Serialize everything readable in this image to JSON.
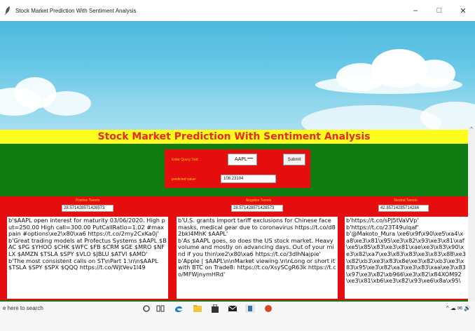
{
  "window": {
    "title": "Stock Market Prediction With Sentiment Analysis",
    "controls": {
      "minimize": "–",
      "maximize": "□",
      "close": "✕"
    }
  },
  "header": {
    "title": "Stock Market Prediction With Sentiment Analysis"
  },
  "query": {
    "label": "Enter Query Text:",
    "selected": "AAPL",
    "submit_label": "Submit",
    "predicted_label": "predicted value:",
    "predicted_value": "108.23104"
  },
  "columns": {
    "positive": {
      "label": "Positive Tweets",
      "score": "28.571428571428573",
      "lines": [
        "b'$AAPL open interest for maturity 03/06/2020. High put=250.00 High call=300.00 PutCallRatio=1.02 #maxpain #options\\xe2\\x80\\xa6 https://t.co/2my2CxKa0j'",
        "b'Great trading models at Profectus Systems $AAPL $BAC $PG $YHOO $CHK $WFC $FB $CRM $GE $MRO $NFLX $AMZN $TSLA $SPY $VLO $JBLU $ATVI $AMD'",
        "b'The most consistent calls on ST\\nPart 1.\\n\\n$AAPL $TSLA $SPY $SPX $QQQ https://t.co/WjtVev1l49"
      ]
    },
    "negative": {
      "label": "Negative Tweets",
      "score": "28.571428571428573",
      "lines": [
        "b'U.S. grants import tariff exclusions for Chinese face masks, medical gear due to coronavirus https://t.co/d82bkl4MhK $AAPL'",
        "b'As $AAPL goes, so does the US stock market. Heavy volume and mostly on advancing days. Out of your mind if you thin\\xe2\\x80\\xa6 https://t.co/3dlhNajpie'",
        "b'Apple | $AAPL\\n\\nMarket viewing.\\n\\nLong or short it with BTC on Trade8: https://t.co/XsySCgR63k https://t.co/MFWjnymHRd'"
      ]
    },
    "neutral": {
      "label": "Neutral Tweets",
      "score": "42.85714285714286",
      "lines": [
        "b'https://t.co/sPJ5tVaVVp'",
        "b'https://t.co/23T49ulqaf'",
        "b'@Makoto_Mura \\xe6\\x9f\\x90\\xe5\\xa4\\xa8\\xe3\\x81\\x95\\xe3\\x82\\x93\\xe3\\x81\\xaf\\xe5\\x85\\x83\\xe3\\x81\\xae\\xe3\\x83\\x90\\xe3\\x82\\xa7\\xe3\\x83\\x83\\xe3\\x83\\x88\\xe3\\x82\\xb3\\xe3\\x83\\x8e\\xe3\\x82\\xb3\\xe3\\x83\\x95\\xe3\\x82\\xa3\\xe3\\x83\\xaa\\xe3\\x83\\x97\\xe3\\x82\\xb966\\xe3\\x82\\x84XOM92\\xe3\\x81\\xb6\\xe3\\x82\\x93\\xe6\\x8a\\x95\\"
      ]
    }
  },
  "taskbar": {
    "search_placeholder": "e here to search"
  },
  "colors": {
    "banner": "#fffd1c",
    "title_text": "#e8291c",
    "panel": "#e50d0d",
    "background": "#0e7c10"
  }
}
